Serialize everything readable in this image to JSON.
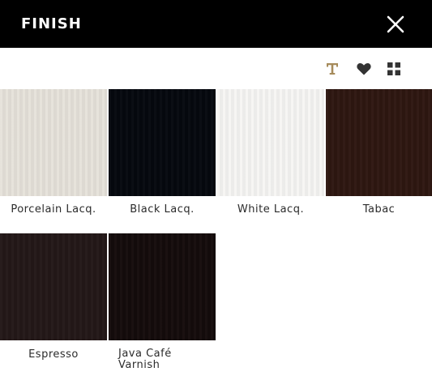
{
  "header": {
    "title": "FINISH"
  },
  "icons": {
    "close": "close-icon",
    "text_view": "text-view-icon",
    "favorites": "heart-icon",
    "grid_view": "grid-icon"
  },
  "colors": {
    "header_bg": "#000000",
    "tool_accent": "#a68b5b",
    "tool_default": "#333333"
  },
  "finishes": [
    {
      "name": "Porcelain Lacq.",
      "color": "#e6e2da"
    },
    {
      "name": "Black Lacq.",
      "color": "#05080e"
    },
    {
      "name": "White Lacq.",
      "color": "#f6f5f3"
    },
    {
      "name": "Tabac",
      "color": "#2e1711"
    },
    {
      "name": "Espresso",
      "color": "#231818"
    },
    {
      "name": "Java Café Varnish",
      "color": "#140b0b"
    }
  ]
}
